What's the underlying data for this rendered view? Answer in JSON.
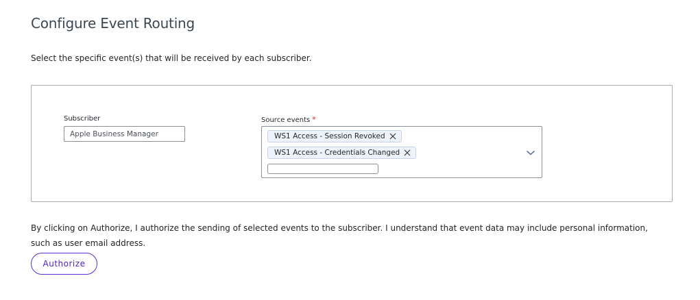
{
  "page": {
    "title": "Configure Event Routing",
    "subtitle": "Select the specific event(s) that will be received by each subscriber."
  },
  "subscriber": {
    "label": "Subscriber",
    "value": "Apple Business Manager"
  },
  "source_events": {
    "label": "Source events",
    "required_mark": "*",
    "selected": [
      {
        "label": "WS1 Access - Session Revoked",
        "remove_icon": "close-icon"
      },
      {
        "label": "WS1 Access - Credentials Changed",
        "remove_icon": "close-icon"
      }
    ],
    "filter_value": "",
    "toggle_icon": "chevron-down-icon"
  },
  "consent": {
    "text": "By clicking on Authorize, I authorize the sending of selected events to the subscriber. I understand that event data may include personal information, such as user email address."
  },
  "actions": {
    "authorize_label": "Authorize"
  },
  "colors": {
    "accent": "#5b2bd6",
    "chip_background": "#eef3fa",
    "required": "#e02020"
  }
}
